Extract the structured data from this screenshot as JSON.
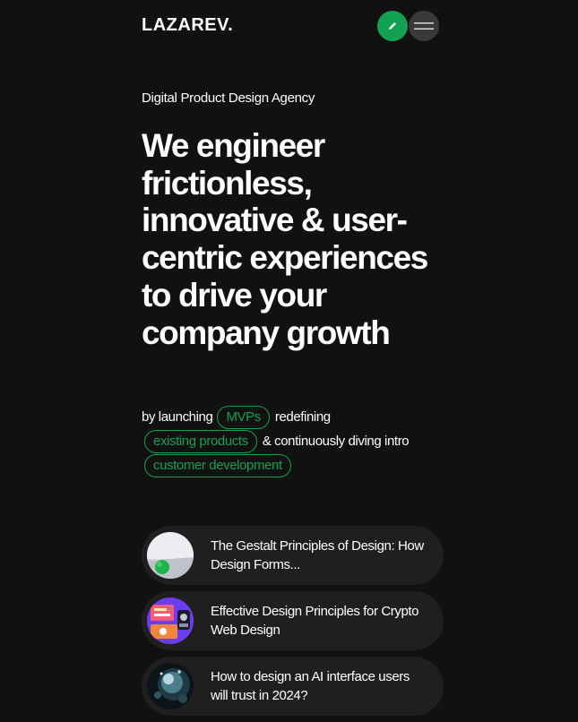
{
  "header": {
    "logo": "LAZAREV.",
    "edit_icon": "pencil-icon",
    "menu_icon": "hamburger-icon"
  },
  "hero": {
    "tagline": "Digital Product Design Agency",
    "headline": "We engineer frictionless, innovative & user-centric experiences to drive your company growth",
    "sub": {
      "prefix": "by launching",
      "pill_1": "MVPs",
      "middle": "redefining",
      "pill_2": "existing products",
      "after": "& continuously diving intro",
      "pill_3": "customer development"
    }
  },
  "articles": [
    {
      "title": "The Gestalt Principles of Design: How Design Forms..."
    },
    {
      "title": "Effective Design Principles for Crypto Web Design"
    },
    {
      "title": "How to design an AI interface users will trust in 2024?"
    }
  ],
  "colors": {
    "background": "#111111",
    "accent_green": "#12a150",
    "card_bg": "#1f1f1f",
    "menu_button_bg": "#3a3a3a"
  }
}
